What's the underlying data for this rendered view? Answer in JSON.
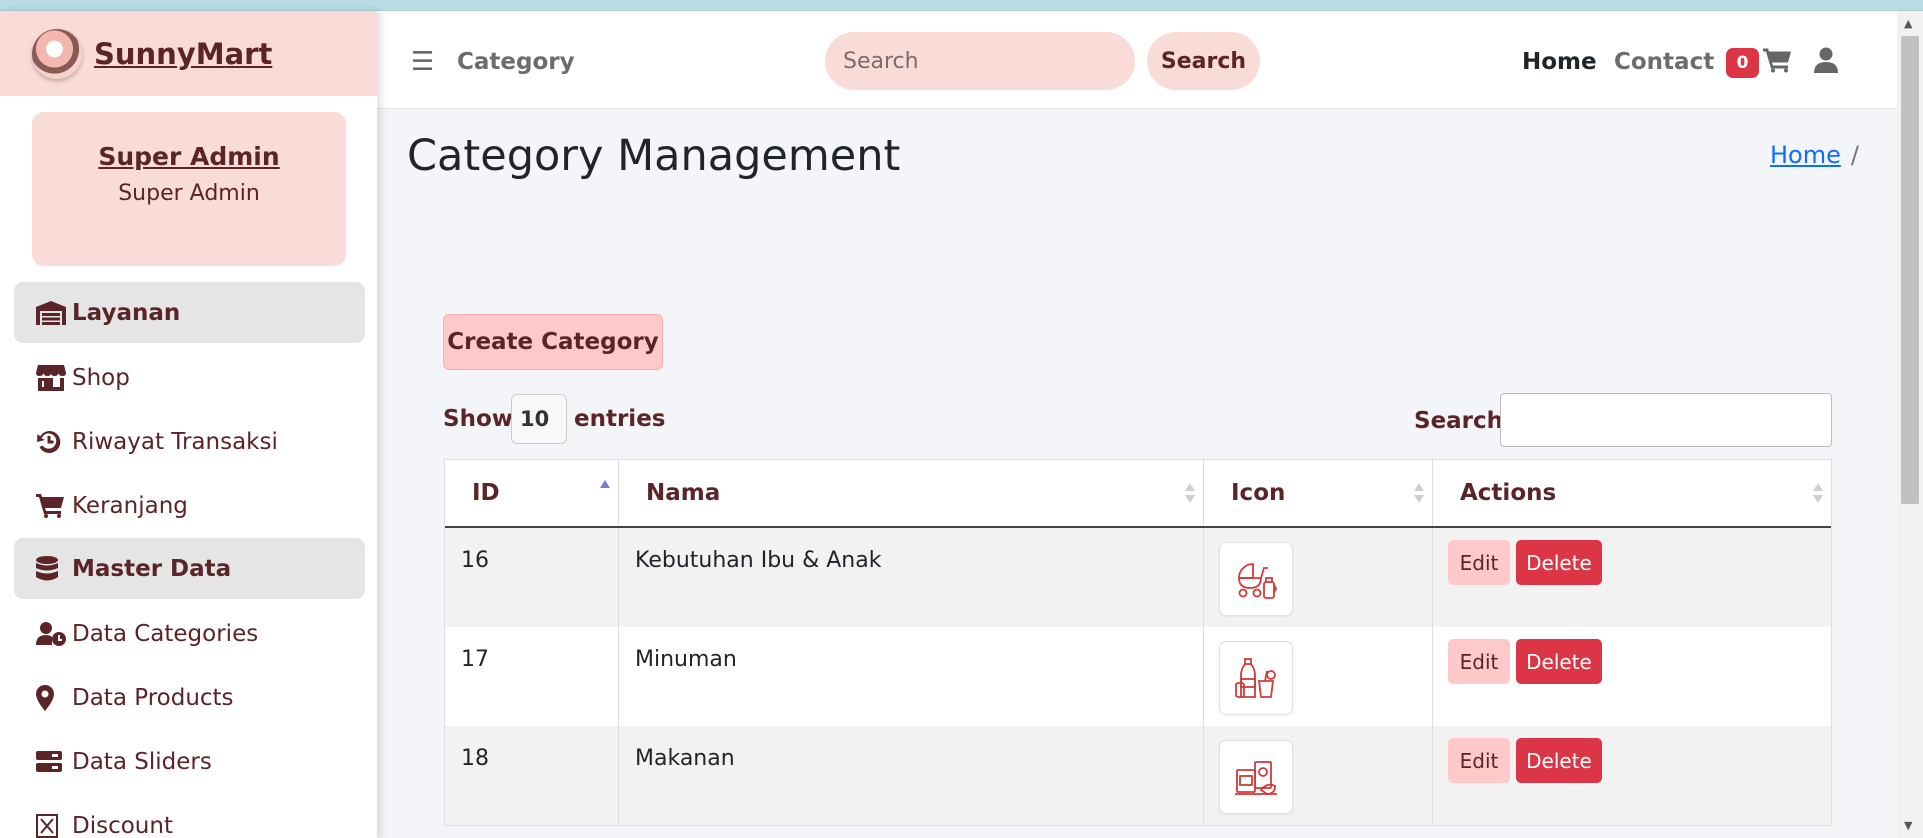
{
  "brand": {
    "name": "SunnyMart"
  },
  "user": {
    "name": "Super Admin",
    "role": "Super Admin"
  },
  "sidebar": {
    "sections": [
      {
        "label": "Layanan",
        "icon": "warehouse-icon"
      },
      {
        "label": "Master Data",
        "icon": "database-icon"
      }
    ],
    "items": [
      {
        "label": "Shop",
        "icon": "store-icon"
      },
      {
        "label": "Riwayat Transaksi",
        "icon": "history-icon"
      },
      {
        "label": "Keranjang",
        "icon": "cart-icon"
      },
      {
        "label": "Data Categories",
        "icon": "user-clock-icon"
      },
      {
        "label": "Data Products",
        "icon": "location-pin-icon"
      },
      {
        "label": "Data Sliders",
        "icon": "server-icon"
      },
      {
        "label": "Discount",
        "icon": "ticket-icon"
      }
    ]
  },
  "navbar": {
    "category_label": "Category",
    "search_placeholder": "Search",
    "search_button": "Search",
    "home_label": "Home",
    "contact_label": "Contact",
    "cart_count": "0"
  },
  "page": {
    "title": "Category Management",
    "breadcrumb_home": "Home",
    "breadcrumb_sep": "/",
    "create_button": "Create Category"
  },
  "table_controls": {
    "show_label": "Show",
    "entries_value": "10",
    "entries_label": "entries",
    "search_label": "Search:"
  },
  "table": {
    "headers": {
      "id": "ID",
      "nama": "Nama",
      "icon": "Icon",
      "actions": "Actions"
    },
    "rows": [
      {
        "id": "16",
        "nama": "Kebutuhan Ibu & Anak",
        "icon": "baby-stroller-icon"
      },
      {
        "id": "17",
        "nama": "Minuman",
        "icon": "drinks-icon"
      },
      {
        "id": "18",
        "nama": "Makanan",
        "icon": "food-icon"
      }
    ],
    "edit_label": "Edit",
    "delete_label": "Delete"
  },
  "colors": {
    "accent": "#f9dbd8",
    "button_pink": "#ffc9c9",
    "brand_text": "#5a2428",
    "danger": "#dc3545",
    "link": "#0d6efd"
  }
}
